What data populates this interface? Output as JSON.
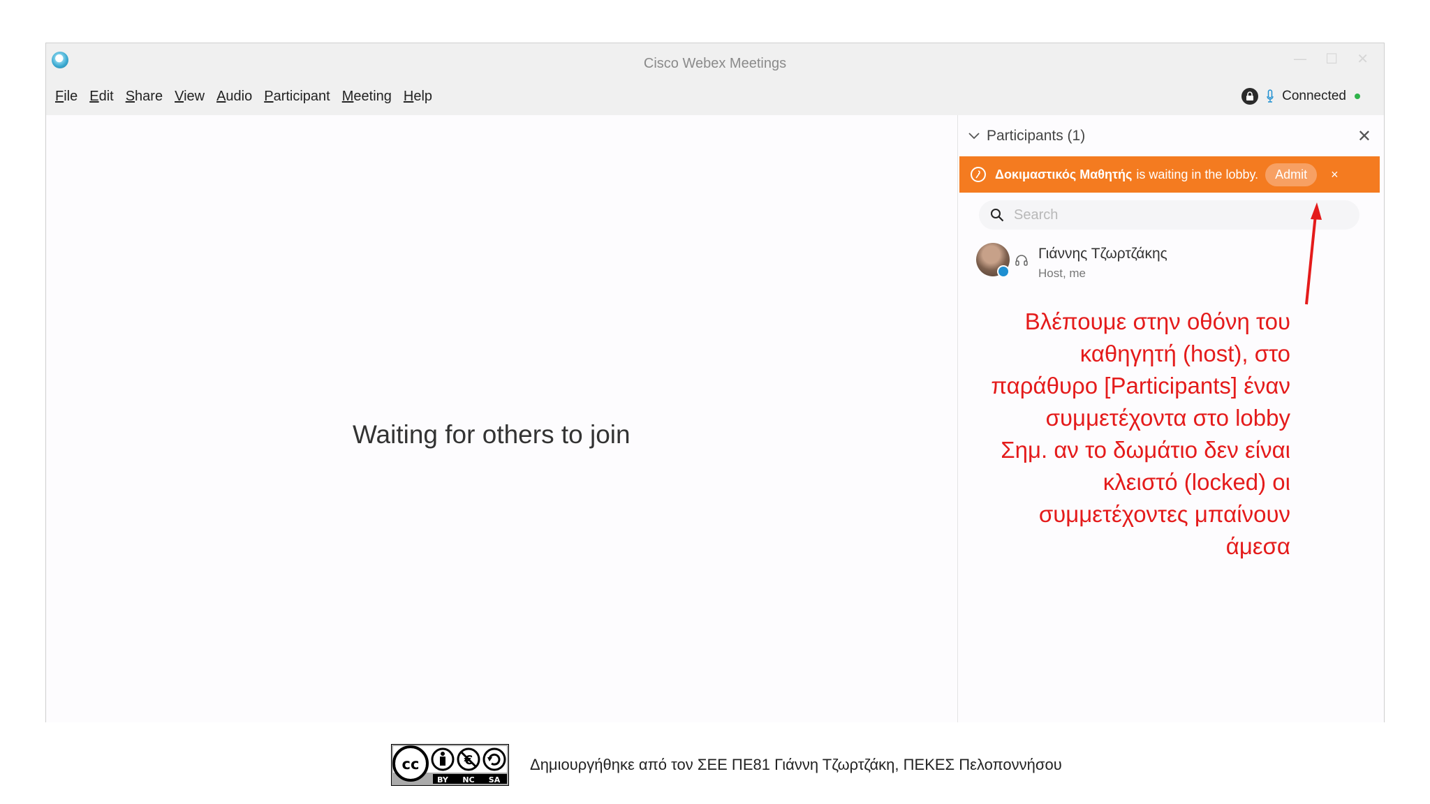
{
  "window": {
    "title": "Cisco Webex Meetings",
    "controls": {
      "minimize": "—",
      "maximize": "☐",
      "close": "✕"
    }
  },
  "menu": {
    "items": [
      "File",
      "Edit",
      "Share",
      "View",
      "Audio",
      "Participant",
      "Meeting",
      "Help"
    ]
  },
  "status": {
    "label": "Connected",
    "dot_color": "#2fb34a"
  },
  "stage": {
    "message": "Waiting for others to join"
  },
  "participants_panel": {
    "header": "Participants (1)",
    "close": "✕",
    "lobby": {
      "name": "Δοκιμαστικός Μαθητής",
      "message": "is waiting in the lobby.",
      "admit_label": "Admit",
      "dismiss": "×",
      "color": "#f47b20"
    },
    "search": {
      "placeholder": "Search"
    },
    "list": [
      {
        "name": "Γιάννης Τζωρτζάκης",
        "role": "Host, me"
      }
    ]
  },
  "annotation": {
    "lines": [
      "Βλέπουμε στην οθόνη του",
      "καθηγητή (host), στο",
      "παράθυρο [Participants] έναν",
      "συμμετέχοντα στο lobby",
      "Σημ. αν το δωμάτιο δεν είναι",
      "κλειστό (locked) οι",
      "συμμετέχοντες μπαίνουν",
      "άμεσα"
    ],
    "color": "#e41b1b"
  },
  "footer": {
    "license_badge": {
      "top": "cc",
      "labels": [
        "BY",
        "NC",
        "SA"
      ]
    },
    "credit": "Δημιουργήθηκε από τον ΣΕΕ ΠΕ81 Γιάννη Τζωρτζάκη, ΠΕΚΕΣ Πελοποννήσου"
  }
}
